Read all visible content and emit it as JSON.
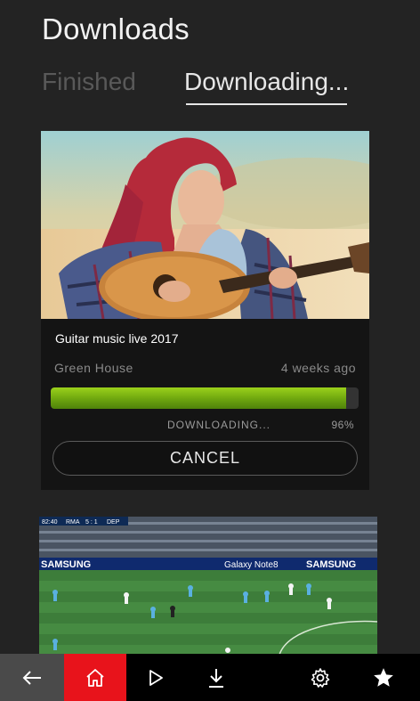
{
  "header": {
    "title": "Downloads"
  },
  "tabs": [
    {
      "label": "Finished",
      "active": false
    },
    {
      "label": "Downloading...",
      "active": true
    }
  ],
  "download_item": {
    "title": "Guitar music live 2017",
    "author": "Green House",
    "date": "4 weeks ago",
    "progress_fraction": 0.96,
    "status_label": "DOWNLOADING...",
    "status_percent": "96%",
    "cancel_label": "CANCEL"
  },
  "second_item": {
    "scoreboard": {
      "time": "82:40",
      "home": "RMA",
      "score": "5 : 1",
      "away": "DEP"
    },
    "banner_texts": [
      "SAMSUNG",
      "Galaxy Note8",
      "SAMSUNG"
    ]
  },
  "navbar": {
    "items": [
      "back-icon",
      "home-icon",
      "play-icon",
      "download-icon",
      "gear-icon",
      "star-icon"
    ],
    "colors": {
      "back_bg": "#4a4a4a",
      "home_bg": "#e8131b",
      "bar_bg": "#000000"
    }
  },
  "colors": {
    "background": "#232323",
    "card": "#141414",
    "progress": "#7fbf12"
  }
}
